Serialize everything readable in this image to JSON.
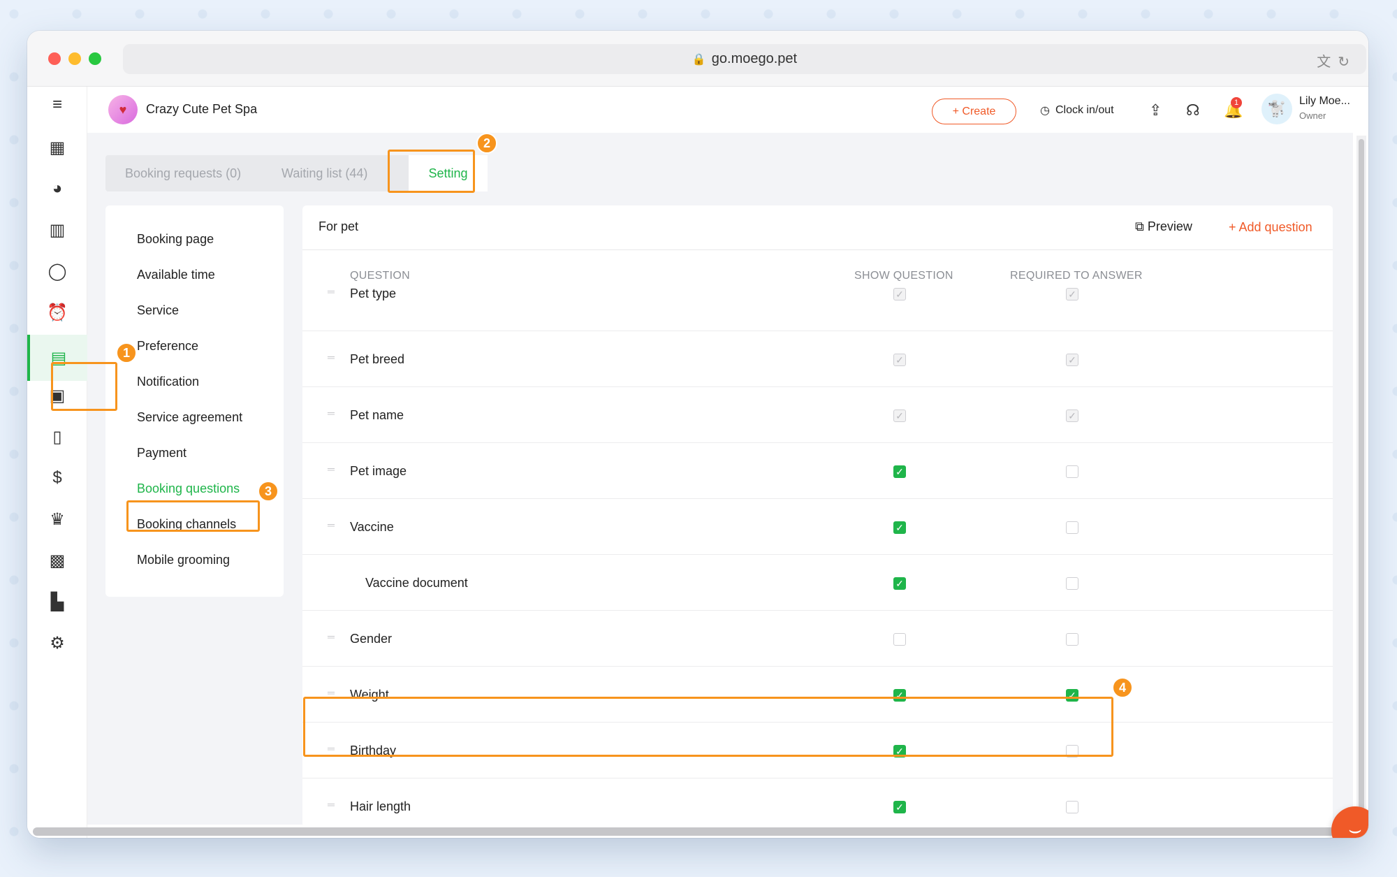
{
  "browser": {
    "url": "go.moego.pet"
  },
  "header": {
    "business_name": "Crazy Cute Pet Spa",
    "create_label": "+ Create",
    "clock_label": "Clock in/out",
    "notification_count": "1",
    "user_name": "Lily Moe...",
    "user_role": "Owner"
  },
  "tabs": [
    {
      "label": "Booking requests (0)"
    },
    {
      "label": "Waiting list (44)"
    },
    {
      "label": "Setting"
    }
  ],
  "settings_menu": [
    {
      "label": "Booking page"
    },
    {
      "label": "Available time"
    },
    {
      "label": "Service"
    },
    {
      "label": "Preference"
    },
    {
      "label": "Notification"
    },
    {
      "label": "Service agreement"
    },
    {
      "label": "Payment"
    },
    {
      "label": "Booking questions"
    },
    {
      "label": "Booking channels"
    },
    {
      "label": "Mobile grooming"
    }
  ],
  "panel": {
    "title": "For pet",
    "preview_label": "Preview",
    "add_question_label": "+ Add question",
    "columns": [
      "QUESTION",
      "SHOW QUESTION",
      "REQUIRED TO ANSWER"
    ],
    "questions": [
      {
        "label": "Pet type",
        "show": "disabled",
        "required": "disabled"
      },
      {
        "label": "Pet breed",
        "show": "disabled",
        "required": "disabled"
      },
      {
        "label": "Pet name",
        "show": "disabled",
        "required": "disabled"
      },
      {
        "label": "Pet image",
        "show": "on",
        "required": "off"
      },
      {
        "label": "Vaccine",
        "show": "on",
        "required": "off"
      },
      {
        "label": "Vaccine document",
        "show": "on",
        "required": "off"
      },
      {
        "label": "Gender",
        "show": "off",
        "required": "off"
      },
      {
        "label": "Weight",
        "show": "on",
        "required": "on"
      },
      {
        "label": "Birthday",
        "show": "on",
        "required": "off"
      },
      {
        "label": "Hair length",
        "show": "on",
        "required": "off"
      }
    ]
  },
  "annotations": [
    "1",
    "2",
    "3",
    "4"
  ],
  "colors": {
    "accent_green": "#1fb54a",
    "accent_orange": "#f05a28",
    "annotation_orange": "#f7941d"
  }
}
